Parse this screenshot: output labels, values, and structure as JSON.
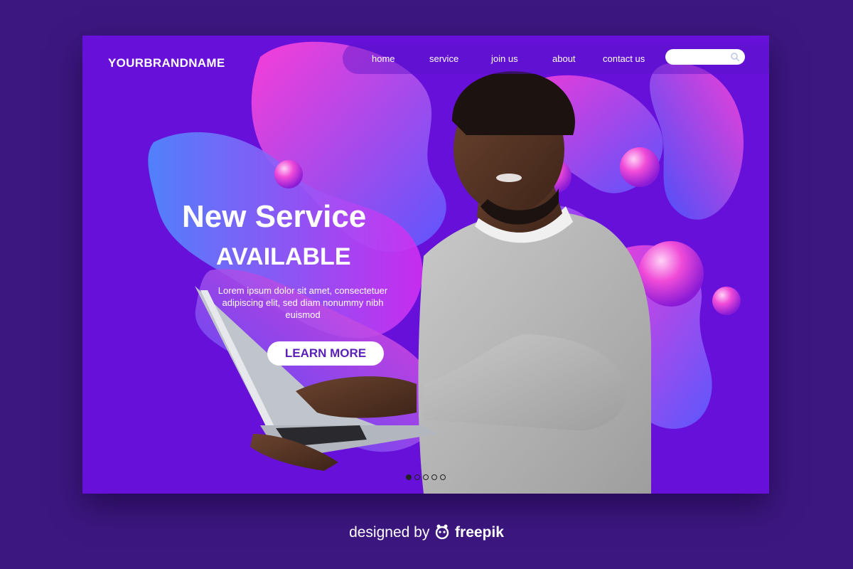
{
  "brand": {
    "name": "YOURBRANDNAME"
  },
  "nav": {
    "items": [
      {
        "label": "home"
      },
      {
        "label": "service"
      },
      {
        "label": "join us"
      },
      {
        "label": "about"
      },
      {
        "label": "contact us"
      }
    ],
    "search": {
      "placeholder": "",
      "icon": "search-icon"
    }
  },
  "hero": {
    "title": "New Service",
    "subtitle": "AVAILABLE",
    "body": "Lorem ipsum dolor sit amet, consectetuer adipiscing elit, sed diam nonummy nibh euismod",
    "cta_label": "LEARN MORE"
  },
  "pager": {
    "count": 5,
    "active_index": 0
  },
  "credit": {
    "prefix": "designed by",
    "brand": "freepik",
    "icon": "freepik-logo-icon"
  },
  "colors": {
    "page_background": "#3c1780",
    "card_background": "#6610d9",
    "accent_pink": "#ff2fd2",
    "accent_blue": "#4f6fff",
    "cta_text": "#5a1fb8"
  }
}
